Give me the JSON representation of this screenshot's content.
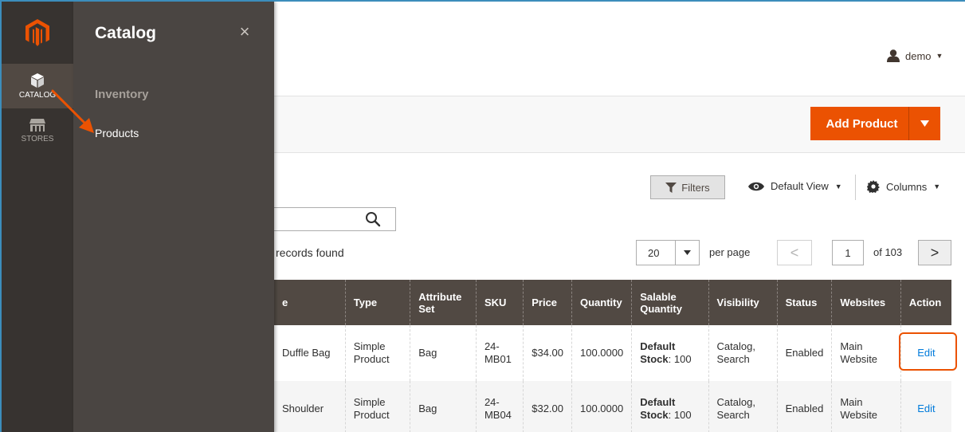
{
  "rail": {
    "items": [
      {
        "label": "CATALOG",
        "icon": "box-icon",
        "active": true
      },
      {
        "label": "STORES",
        "icon": "storefront-icon",
        "active": false
      }
    ]
  },
  "flyout": {
    "title": "Catalog",
    "close_symbol": "×",
    "section": "Inventory",
    "link": "Products"
  },
  "header": {
    "user": "demo"
  },
  "actions": {
    "add_product": "Add Product"
  },
  "toolbar": {
    "filters": "Filters",
    "view": "Default View",
    "columns": "Columns"
  },
  "search": {
    "placeholder": ""
  },
  "records": "records found",
  "pagination": {
    "per_page_value": "20",
    "per_page_label": "per page",
    "prev": "<",
    "page": "1",
    "of": "of 103",
    "next": ">"
  },
  "table": {
    "headers": [
      "e",
      "Type",
      "Attribute Set",
      "SKU",
      "Price",
      "Quantity",
      "Salable Quantity",
      "Visibility",
      "Status",
      "Websites",
      "Action"
    ],
    "rows": [
      {
        "name": "Duffle Bag",
        "type": "Simple Product",
        "attribute_set": "Bag",
        "sku": "24-MB01",
        "price": "$34.00",
        "quantity": "100.0000",
        "salable_label": "Default Stock",
        "salable_value": ": 100",
        "visibility": "Catalog, Search",
        "status": "Enabled",
        "websites": "Main Website",
        "action": "Edit"
      },
      {
        "name": "Shoulder",
        "type": "Simple Product",
        "attribute_set": "Bag",
        "sku": "24-MB04",
        "price": "$32.00",
        "quantity": "100.0000",
        "salable_label": "Default Stock",
        "salable_value": ": 100",
        "visibility": "Catalog, Search",
        "status": "Enabled",
        "websites": "Main Website",
        "action": "Edit"
      }
    ]
  },
  "colors": {
    "accent": "#eb5202",
    "rail_bg": "#373330",
    "flyout_bg": "#4a4542",
    "header_bg": "#514943",
    "link": "#007bdb"
  }
}
